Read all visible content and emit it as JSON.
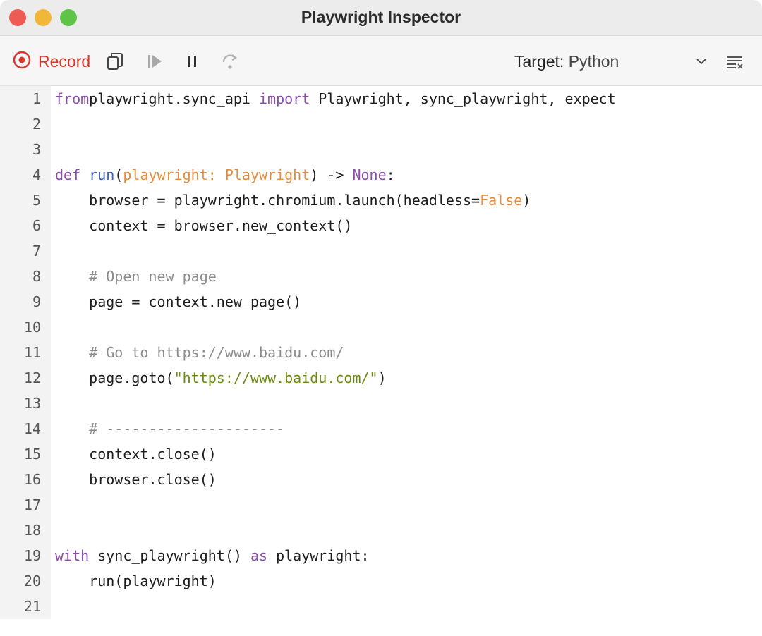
{
  "window": {
    "title": "Playwright Inspector"
  },
  "toolbar": {
    "record_label": "Record",
    "target_label": "Target:",
    "target_value": "Python",
    "accent_color": "#d9362c"
  },
  "code": {
    "line_numbers": [
      "1",
      "2",
      "3",
      "4",
      "5",
      "6",
      "7",
      "8",
      "9",
      "10",
      "11",
      "12",
      "13",
      "14",
      "15",
      "16",
      "17",
      "18",
      "19",
      "20",
      "21"
    ],
    "lines": [
      [
        [
          "kw",
          "from"
        ],
        [
          "",
          "playwright.sync_api "
        ],
        [
          "kw",
          "import"
        ],
        [
          "",
          " Playwright, sync_playwright, expect"
        ]
      ],
      [],
      [],
      [
        [
          "kw",
          "def"
        ],
        [
          "",
          " "
        ],
        [
          "fn",
          "run"
        ],
        [
          "",
          "("
        ],
        [
          "param",
          "playwright: Playwright"
        ],
        [
          "",
          ") -> "
        ],
        [
          "kw",
          "None"
        ],
        [
          "",
          ":"
        ]
      ],
      [
        [
          "",
          "    browser = playwright.chromium.launch(headless="
        ],
        [
          "param",
          "False"
        ],
        [
          "",
          ")"
        ]
      ],
      [
        [
          "",
          "    context = browser.new_context()"
        ]
      ],
      [],
      [
        [
          "",
          "    "
        ],
        [
          "cmt",
          "# Open new page"
        ]
      ],
      [
        [
          "",
          "    page = context.new_page()"
        ]
      ],
      [],
      [
        [
          "",
          "    "
        ],
        [
          "cmt",
          "# Go to https://www.baidu.com/"
        ]
      ],
      [
        [
          "",
          "    page.goto("
        ],
        [
          "str",
          "\"https://www.baidu.com/\""
        ],
        [
          "",
          ")"
        ]
      ],
      [],
      [
        [
          "",
          "    "
        ],
        [
          "cmt",
          "# ---------------------"
        ]
      ],
      [
        [
          "",
          "    context.close()"
        ]
      ],
      [
        [
          "",
          "    browser.close()"
        ]
      ],
      [],
      [],
      [
        [
          "kw",
          "with"
        ],
        [
          "",
          " sync_playwright() "
        ],
        [
          "kw",
          "as"
        ],
        [
          "",
          " playwright:"
        ]
      ],
      [
        [
          "",
          "    run(playwright)"
        ]
      ],
      []
    ]
  }
}
